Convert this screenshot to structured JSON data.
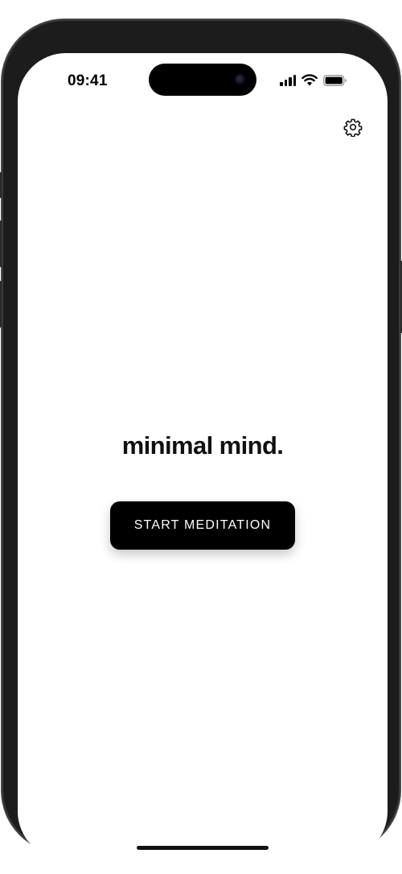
{
  "status_bar": {
    "time": "09:41",
    "icons": [
      "cellular-signal-icon",
      "wifi-icon",
      "battery-icon"
    ]
  },
  "header": {
    "settings_icon": "gear-icon"
  },
  "main": {
    "title": "minimal mind.",
    "start_button_label": "START MEDITATION"
  },
  "colors": {
    "background": "#ffffff",
    "button": "#000000",
    "button_text": "#ffffff",
    "title_text": "#111111"
  }
}
